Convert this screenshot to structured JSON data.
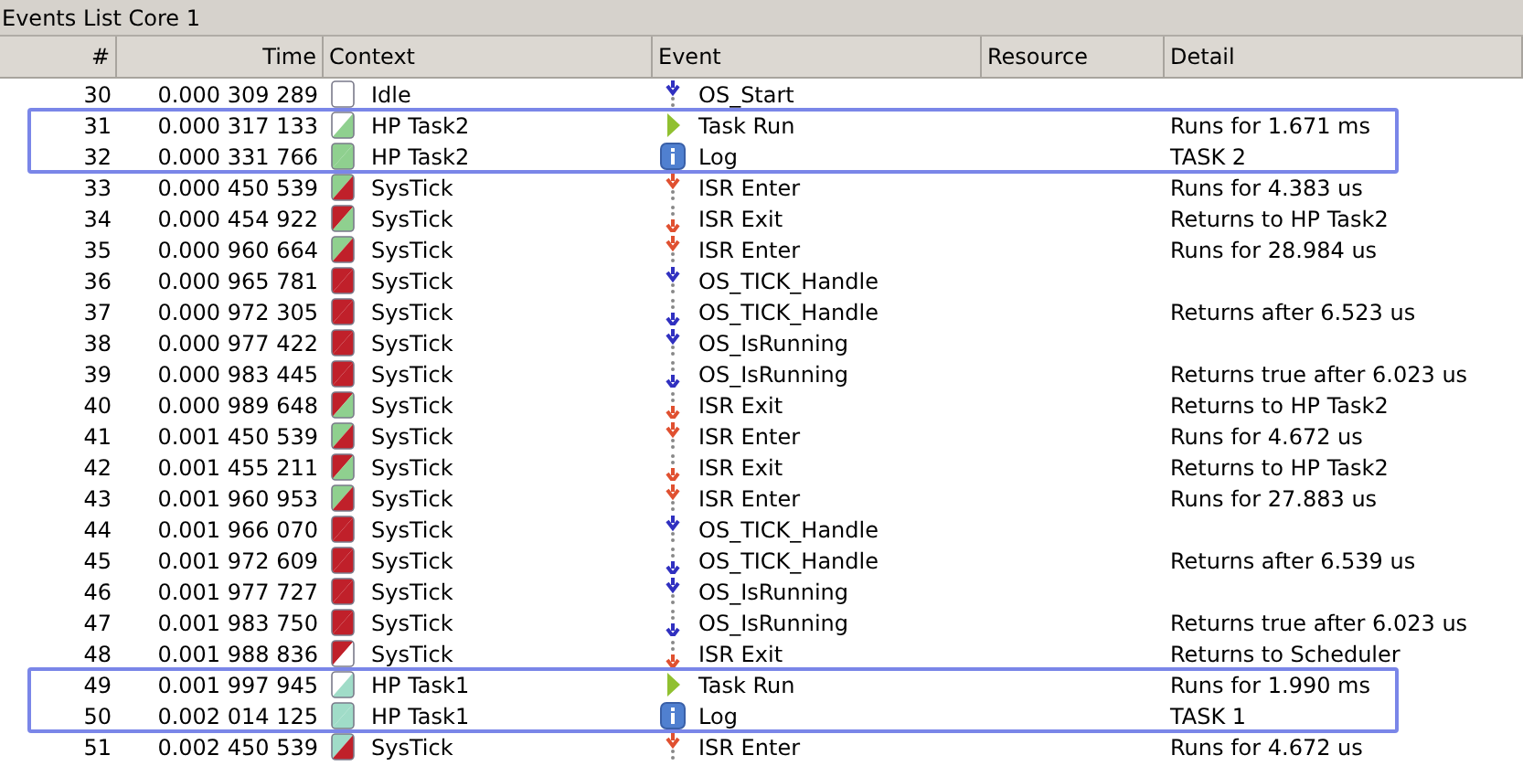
{
  "panel_title": "Events List Core 1",
  "columns": [
    "#",
    "Time",
    "Context",
    "Event",
    "Resource",
    "Detail"
  ],
  "rows": [
    {
      "n": "30",
      "time": "0.000 309 289",
      "context": {
        "name": "Idle",
        "halves": [
          {
            "color": "#ffffff"
          },
          {
            "color": "#ffffff"
          }
        ]
      },
      "event": {
        "kind": "call",
        "color": "#3030c0",
        "name": "OS_Start"
      },
      "detail": "",
      "highlighted": false
    },
    {
      "n": "31",
      "time": "0.000 317 133",
      "context": {
        "name": "HP Task2",
        "halves": [
          {
            "color": "#ffffff"
          },
          {
            "color": "#8fd08f"
          }
        ]
      },
      "event": {
        "kind": "run",
        "color": "#90c030",
        "name": "Task Run"
      },
      "detail": "Runs for 1.671 ms",
      "highlighted": true
    },
    {
      "n": "32",
      "time": "0.000 331 766",
      "context": {
        "name": "HP Task2",
        "halves": [
          {
            "color": "#8fd08f"
          },
          {
            "color": "#8fd08f"
          }
        ]
      },
      "event": {
        "kind": "log",
        "color": "#5080d0",
        "name": "Log"
      },
      "detail": "TASK 2",
      "highlighted": true
    },
    {
      "n": "33",
      "time": "0.000 450 539",
      "context": {
        "name": "SysTick",
        "halves": [
          {
            "color": "#8fd08f"
          },
          {
            "color": "#c0202a"
          }
        ]
      },
      "event": {
        "kind": "call",
        "color": "#e05030",
        "name": "ISR Enter"
      },
      "detail": "Runs for 4.383 us",
      "highlighted": false
    },
    {
      "n": "34",
      "time": "0.000 454 922",
      "context": {
        "name": "SysTick",
        "halves": [
          {
            "color": "#c0202a"
          },
          {
            "color": "#8fd08f"
          }
        ]
      },
      "event": {
        "kind": "return",
        "color": "#e05030",
        "name": "ISR Exit"
      },
      "detail": "Returns to HP Task2",
      "highlighted": false
    },
    {
      "n": "35",
      "time": "0.000 960 664",
      "context": {
        "name": "SysTick",
        "halves": [
          {
            "color": "#8fd08f"
          },
          {
            "color": "#c0202a"
          }
        ]
      },
      "event": {
        "kind": "call",
        "color": "#e05030",
        "name": "ISR Enter"
      },
      "detail": "Runs for 28.984 us",
      "highlighted": false
    },
    {
      "n": "36",
      "time": "0.000 965 781",
      "context": {
        "name": "SysTick",
        "halves": [
          {
            "color": "#c0202a"
          },
          {
            "color": "#c0202a"
          }
        ]
      },
      "event": {
        "kind": "call",
        "color": "#3030c0",
        "name": "OS_TICK_Handle"
      },
      "detail": "",
      "highlighted": false
    },
    {
      "n": "37",
      "time": "0.000 972 305",
      "context": {
        "name": "SysTick",
        "halves": [
          {
            "color": "#c0202a"
          },
          {
            "color": "#c0202a"
          }
        ]
      },
      "event": {
        "kind": "return",
        "color": "#3030c0",
        "name": "OS_TICK_Handle"
      },
      "detail": "Returns after 6.523 us",
      "highlighted": false
    },
    {
      "n": "38",
      "time": "0.000 977 422",
      "context": {
        "name": "SysTick",
        "halves": [
          {
            "color": "#c0202a"
          },
          {
            "color": "#c0202a"
          }
        ]
      },
      "event": {
        "kind": "call",
        "color": "#3030c0",
        "name": "OS_IsRunning"
      },
      "detail": "",
      "highlighted": false
    },
    {
      "n": "39",
      "time": "0.000 983 445",
      "context": {
        "name": "SysTick",
        "halves": [
          {
            "color": "#c0202a"
          },
          {
            "color": "#c0202a"
          }
        ]
      },
      "event": {
        "kind": "return",
        "color": "#3030c0",
        "name": "OS_IsRunning"
      },
      "detail": "Returns true after 6.023 us",
      "highlighted": false
    },
    {
      "n": "40",
      "time": "0.000 989 648",
      "context": {
        "name": "SysTick",
        "halves": [
          {
            "color": "#c0202a"
          },
          {
            "color": "#8fd08f"
          }
        ]
      },
      "event": {
        "kind": "return",
        "color": "#e05030",
        "name": "ISR Exit"
      },
      "detail": "Returns to HP Task2",
      "highlighted": false
    },
    {
      "n": "41",
      "time": "0.001 450 539",
      "context": {
        "name": "SysTick",
        "halves": [
          {
            "color": "#8fd08f"
          },
          {
            "color": "#c0202a"
          }
        ]
      },
      "event": {
        "kind": "call",
        "color": "#e05030",
        "name": "ISR Enter"
      },
      "detail": "Runs for 4.672 us",
      "highlighted": false
    },
    {
      "n": "42",
      "time": "0.001 455 211",
      "context": {
        "name": "SysTick",
        "halves": [
          {
            "color": "#c0202a"
          },
          {
            "color": "#8fd08f"
          }
        ]
      },
      "event": {
        "kind": "return",
        "color": "#e05030",
        "name": "ISR Exit"
      },
      "detail": "Returns to HP Task2",
      "highlighted": false
    },
    {
      "n": "43",
      "time": "0.001 960 953",
      "context": {
        "name": "SysTick",
        "halves": [
          {
            "color": "#8fd08f"
          },
          {
            "color": "#c0202a"
          }
        ]
      },
      "event": {
        "kind": "call",
        "color": "#e05030",
        "name": "ISR Enter"
      },
      "detail": "Runs for 27.883 us",
      "highlighted": false
    },
    {
      "n": "44",
      "time": "0.001 966 070",
      "context": {
        "name": "SysTick",
        "halves": [
          {
            "color": "#c0202a"
          },
          {
            "color": "#c0202a"
          }
        ]
      },
      "event": {
        "kind": "call",
        "color": "#3030c0",
        "name": "OS_TICK_Handle"
      },
      "detail": "",
      "highlighted": false
    },
    {
      "n": "45",
      "time": "0.001 972 609",
      "context": {
        "name": "SysTick",
        "halves": [
          {
            "color": "#c0202a"
          },
          {
            "color": "#c0202a"
          }
        ]
      },
      "event": {
        "kind": "return",
        "color": "#3030c0",
        "name": "OS_TICK_Handle"
      },
      "detail": "Returns after 6.539 us",
      "highlighted": false
    },
    {
      "n": "46",
      "time": "0.001 977 727",
      "context": {
        "name": "SysTick",
        "halves": [
          {
            "color": "#c0202a"
          },
          {
            "color": "#c0202a"
          }
        ]
      },
      "event": {
        "kind": "call",
        "color": "#3030c0",
        "name": "OS_IsRunning"
      },
      "detail": "",
      "highlighted": false
    },
    {
      "n": "47",
      "time": "0.001 983 750",
      "context": {
        "name": "SysTick",
        "halves": [
          {
            "color": "#c0202a"
          },
          {
            "color": "#c0202a"
          }
        ]
      },
      "event": {
        "kind": "return",
        "color": "#3030c0",
        "name": "OS_IsRunning"
      },
      "detail": "Returns true after 6.023 us",
      "highlighted": false
    },
    {
      "n": "48",
      "time": "0.001 988 836",
      "context": {
        "name": "SysTick",
        "halves": [
          {
            "color": "#c0202a"
          },
          {
            "color": "#ffffff"
          }
        ]
      },
      "event": {
        "kind": "return",
        "color": "#e05030",
        "name": "ISR Exit"
      },
      "detail": "Returns to Scheduler",
      "highlighted": false
    },
    {
      "n": "49",
      "time": "0.001 997 945",
      "context": {
        "name": "HP Task1",
        "halves": [
          {
            "color": "#ffffff"
          },
          {
            "color": "#a0dcc8"
          }
        ]
      },
      "event": {
        "kind": "run",
        "color": "#90c030",
        "name": "Task Run"
      },
      "detail": "Runs for 1.990 ms",
      "highlighted": true
    },
    {
      "n": "50",
      "time": "0.002 014 125",
      "context": {
        "name": "HP Task1",
        "halves": [
          {
            "color": "#a0dcc8"
          },
          {
            "color": "#a0dcc8"
          }
        ]
      },
      "event": {
        "kind": "log",
        "color": "#5080d0",
        "name": "Log"
      },
      "detail": "TASK 1",
      "highlighted": true
    },
    {
      "n": "51",
      "time": "0.002 450 539",
      "context": {
        "name": "SysTick",
        "halves": [
          {
            "color": "#a0dcc8"
          },
          {
            "color": "#c0202a"
          }
        ]
      },
      "event": {
        "kind": "call",
        "color": "#e05030",
        "name": "ISR Enter"
      },
      "detail": "Runs for 4.672 us",
      "highlighted": false
    }
  ]
}
